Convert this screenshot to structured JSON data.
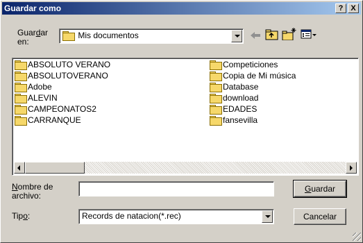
{
  "window": {
    "title": "Guardar como",
    "help_label": "?",
    "close_label": "X"
  },
  "lookin": {
    "label_part1": "Guar",
    "label_accel": "d",
    "label_part2": "ar",
    "label_line2": "en:",
    "value": "Mis documentos",
    "icon": "my-documents-folder-icon"
  },
  "toolbar": {
    "back_icon": "back-arrow-icon",
    "up_icon": "up-folder-icon",
    "new_folder_icon": "new-folder-icon",
    "view_icon": "view-menu-icon"
  },
  "files": {
    "left": [
      "ABSOLUTO VERANO",
      "ABSOLUTOVERANO",
      "Adobe",
      "ALEVIN",
      "CAMPEONATOS2",
      "CARRANQUE"
    ],
    "right": [
      "Competiciones",
      "Copia de Mi música",
      "Database",
      "download",
      "EDADES",
      "fansevilla"
    ],
    "icon": "folder-icon"
  },
  "filename": {
    "label_accel": "N",
    "label_part1": "ombre de",
    "label_line2": "archivo:",
    "value": ""
  },
  "filetype": {
    "label_part1": "Tip",
    "label_accel": "o",
    "label_part2": ":",
    "value": "Records de natacion(*.rec)"
  },
  "buttons": {
    "save_accel": "G",
    "save_rest": "uardar",
    "cancel": "Cancelar"
  },
  "colors": {
    "titlebar_start": "#0a246a",
    "titlebar_end": "#a6caf0",
    "face": "#d4d0c8",
    "folder": "#f6d86a"
  }
}
